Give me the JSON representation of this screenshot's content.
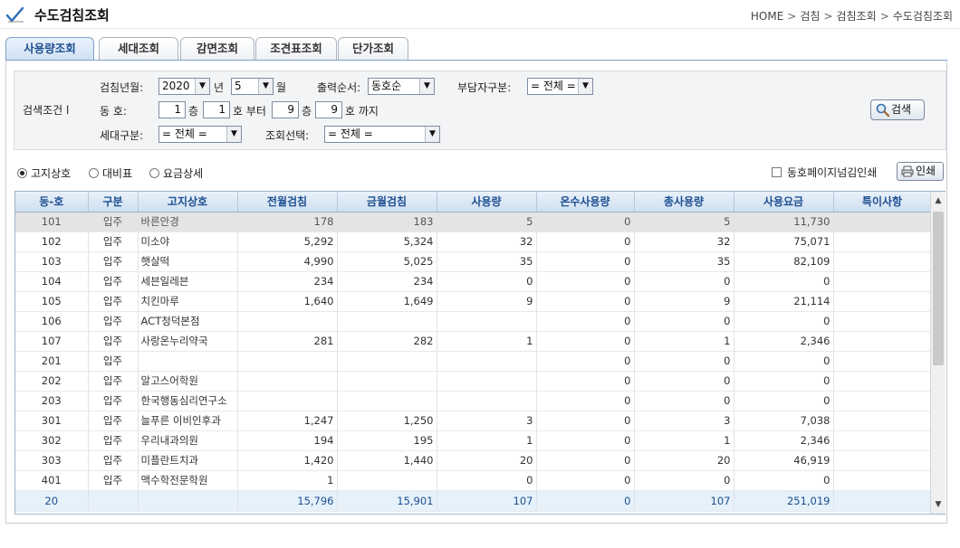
{
  "header": {
    "title": "수도검침조회",
    "breadcrumb": [
      "HOME",
      "검침",
      "검침조회",
      "수도검침조회"
    ],
    "breadcrumb_sep": ">"
  },
  "tabs": [
    {
      "label": "사용량조회",
      "active": true
    },
    {
      "label": "세대조회",
      "active": false
    },
    {
      "label": "감면조회",
      "active": false
    },
    {
      "label": "조견표조회",
      "active": false
    },
    {
      "label": "단가조회",
      "active": false
    }
  ],
  "search": {
    "section_label": "검색조건 l",
    "year_month_label": "검침년월:",
    "year": "2020",
    "year_unit": "년",
    "month": "5",
    "month_unit": "월",
    "order_label": "출력순서:",
    "order": "동호순",
    "payer_label": "부담자구분:",
    "payer": "= 전체 =",
    "dongho_label": "동  호:",
    "from_floor": "1",
    "floor_unit_1": "층",
    "from_ho": "1",
    "ho_from_label": "호 부터",
    "to_floor": "9",
    "floor_unit_2": "층",
    "to_ho": "9",
    "ho_to_label": "호 까지",
    "household_label": "세대구분:",
    "household": "= 전체 =",
    "view_label": "조회선택:",
    "view": "= 전체 =",
    "search_button": "검색"
  },
  "options": {
    "radios": [
      {
        "label": "고지상호",
        "checked": true
      },
      {
        "label": "대비표",
        "checked": false
      },
      {
        "label": "요금상세",
        "checked": false
      }
    ],
    "checkbox_label": "동호페이지넘김인쇄",
    "print_button": "인쇄"
  },
  "table": {
    "columns": [
      "동-호",
      "구분",
      "고지상호",
      "전월검침",
      "금월검침",
      "사용량",
      "온수사용량",
      "총사용량",
      "사용요금",
      "특이사항"
    ],
    "rows": [
      [
        "101",
        "입주",
        "바른안경",
        "178",
        "183",
        "5",
        "0",
        "5",
        "11,730",
        ""
      ],
      [
        "102",
        "입주",
        "미소야",
        "5,292",
        "5,324",
        "32",
        "0",
        "32",
        "75,071",
        ""
      ],
      [
        "103",
        "입주",
        "햇살떡",
        "4,990",
        "5,025",
        "35",
        "0",
        "35",
        "82,109",
        ""
      ],
      [
        "104",
        "입주",
        "세븐일레븐",
        "234",
        "234",
        "0",
        "0",
        "0",
        "0",
        ""
      ],
      [
        "105",
        "입주",
        "치킨마루",
        "1,640",
        "1,649",
        "9",
        "0",
        "9",
        "21,114",
        ""
      ],
      [
        "106",
        "입주",
        "ACT청덕본점",
        "",
        "",
        "",
        "0",
        "0",
        "0",
        ""
      ],
      [
        "107",
        "입주",
        "사랑온누리약국",
        "281",
        "282",
        "1",
        "0",
        "1",
        "2,346",
        ""
      ],
      [
        "201",
        "입주",
        "",
        "",
        "",
        "",
        "0",
        "0",
        "0",
        ""
      ],
      [
        "202",
        "입주",
        "알고스어학원",
        "",
        "",
        "",
        "0",
        "0",
        "0",
        ""
      ],
      [
        "203",
        "입주",
        "한국행동심리연구소",
        "",
        "",
        "",
        "0",
        "0",
        "0",
        ""
      ],
      [
        "301",
        "입주",
        "늘푸른 이비인후과",
        "1,247",
        "1,250",
        "3",
        "0",
        "3",
        "7,038",
        ""
      ],
      [
        "302",
        "입주",
        "우리내과의원",
        "194",
        "195",
        "1",
        "0",
        "1",
        "2,346",
        ""
      ],
      [
        "303",
        "입주",
        "미플란트치과",
        "1,420",
        "1,440",
        "20",
        "0",
        "20",
        "46,919",
        ""
      ],
      [
        "401",
        "입주",
        "맥수학전문학원",
        "1",
        "",
        "0",
        "0",
        "0",
        "0",
        ""
      ]
    ],
    "summary": [
      "20",
      "",
      "",
      "15,796",
      "15,901",
      "107",
      "0",
      "107",
      "251,019",
      ""
    ]
  },
  "colors": {
    "accent": "#1d4f91",
    "header_bg": "#cfdff0",
    "summary_bg": "#e6f1fa",
    "selected_row_bg": "#e4e4e4"
  }
}
